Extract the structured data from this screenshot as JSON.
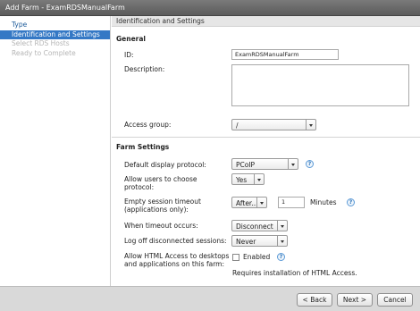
{
  "window": {
    "title": "Add Farm - ExamRDSManualFarm"
  },
  "sidebar": {
    "items": [
      {
        "label": "Type",
        "state": "normal"
      },
      {
        "label": "Identification and Settings",
        "state": "active"
      },
      {
        "label": "Select RDS Hosts",
        "state": "disabled"
      },
      {
        "label": "Ready to Complete",
        "state": "disabled"
      }
    ]
  },
  "main": {
    "header": "Identification and Settings",
    "general": {
      "title": "General",
      "id_label": "ID:",
      "id_value": "ExamRDSManualFarm",
      "description_label": "Description:",
      "access_group_label": "Access group:",
      "access_group_value": "/"
    },
    "farm_settings": {
      "title": "Farm Settings",
      "display_protocol_label": "Default display protocol:",
      "display_protocol_value": "PCoIP",
      "allow_choose_label_1": "Allow users to choose",
      "allow_choose_label_2": "protocol:",
      "allow_choose_value": "Yes",
      "empty_timeout_label_1": "Empty session timeout",
      "empty_timeout_label_2": "(applications only):",
      "empty_timeout_mode": "After...",
      "empty_timeout_value": "1",
      "empty_timeout_unit": "Minutes",
      "timeout_occurs_label": "When timeout occurs:",
      "timeout_occurs_value": "Disconnect",
      "logoff_label": "Log off disconnected sessions:",
      "logoff_value": "Never",
      "html_access_label_1": "Allow HTML Access to desktops",
      "html_access_label_2": "and applications on this farm:",
      "html_access_checkbox_label": "Enabled",
      "html_access_checked": false,
      "html_access_note": "Requires installation of HTML Access."
    }
  },
  "footer": {
    "back_label": "< Back",
    "next_label": "Next >",
    "cancel_label": "Cancel"
  },
  "colors": {
    "accent": "#3478c5",
    "link": "#1c5a99",
    "titlebar": "#666666",
    "footer": "#d9d9d9"
  }
}
